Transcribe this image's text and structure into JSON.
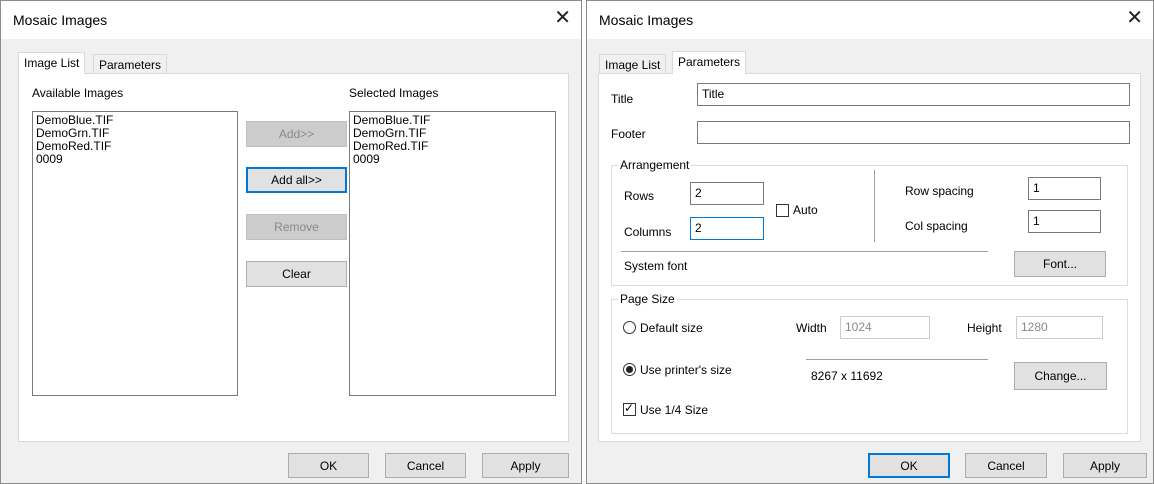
{
  "left_dialog": {
    "title": "Mosaic Images",
    "close_glyph": "✕",
    "tabs": [
      "Image List",
      "Parameters"
    ],
    "available_label": "Available Images",
    "selected_label": "Selected Images",
    "available_images": [
      "DemoBlue.TIF",
      "DemoGrn.TIF",
      "DemoRed.TIF",
      "0009"
    ],
    "selected_images": [
      "DemoBlue.TIF",
      "DemoGrn.TIF",
      "DemoRed.TIF",
      "0009"
    ],
    "buttons": {
      "add": "Add>>",
      "add_all": "Add all>>",
      "remove": "Remove",
      "clear": "Clear"
    },
    "footer": {
      "ok": "OK",
      "cancel": "Cancel",
      "apply": "Apply"
    }
  },
  "right_dialog": {
    "title": "Mosaic Images",
    "close_glyph": "✕",
    "tabs": [
      "Image List",
      "Parameters"
    ],
    "title_label": "Title",
    "title_value": "Title",
    "footer_label": "Footer",
    "footer_value": "",
    "arrangement": {
      "label": "Arrangement",
      "rows_label": "Rows",
      "rows_value": "2",
      "columns_label": "Columns",
      "columns_value": "2",
      "auto_label": "Auto",
      "auto_checked": false,
      "row_spacing_label": "Row spacing",
      "row_spacing_value": "1",
      "col_spacing_label": "Col spacing",
      "col_spacing_value": "1",
      "font_name": "System font",
      "font_button": "Font..."
    },
    "page_size": {
      "label": "Page Size",
      "default_size_label": "Default size",
      "width_label": "Width",
      "width_value": "1024",
      "height_label": "Height",
      "height_value": "1280",
      "printer_size_label": "Use printer's size",
      "printer_size_value": "8267 x 11692",
      "change_button": "Change...",
      "quarter_size_label": "Use 1/4 Size",
      "quarter_checked": true,
      "selected_option": "Use printer's size"
    },
    "footer": {
      "ok": "OK",
      "cancel": "Cancel",
      "apply": "Apply"
    }
  }
}
